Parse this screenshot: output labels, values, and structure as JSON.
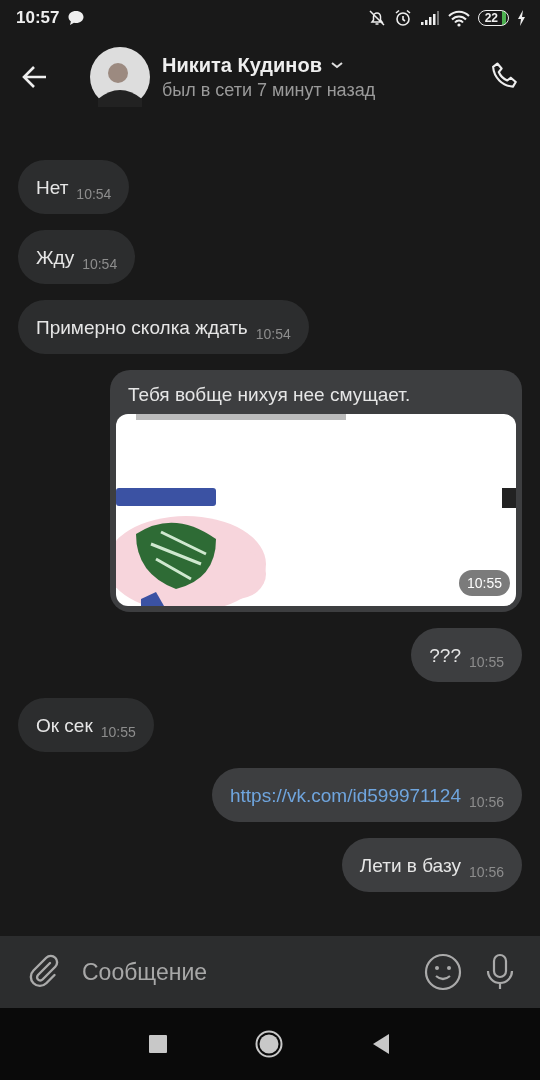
{
  "status_bar": {
    "time": "10:57",
    "battery": "22"
  },
  "header": {
    "name": "Никита Кудинов",
    "status": "был в сети 7 минут назад"
  },
  "messages": [
    {
      "kind": "text",
      "outgoing": false,
      "text": "Нет",
      "time": "10:54"
    },
    {
      "kind": "text",
      "outgoing": false,
      "text": "Жду",
      "time": "10:54"
    },
    {
      "kind": "text",
      "outgoing": false,
      "text": "Примерно сколка ждать",
      "time": "10:54"
    },
    {
      "outgoing": true,
      "text": "Тебя вобще нихуя нее смущает.",
      "time": "10:55"
    },
    {
      "kind": "text",
      "outgoing": true,
      "text": "???",
      "time": "10:55"
    },
    {
      "kind": "text",
      "outgoing": false,
      "text": "Ок сек",
      "time": "10:55"
    },
    {
      "kind": "link",
      "outgoing": true,
      "text": "https://vk.com/id599971124",
      "time": "10:56"
    },
    {
      "kind": "text",
      "outgoing": true,
      "text": "Лети в базу",
      "time": "10:56"
    }
  ],
  "composer": {
    "placeholder": "Сообщение"
  }
}
